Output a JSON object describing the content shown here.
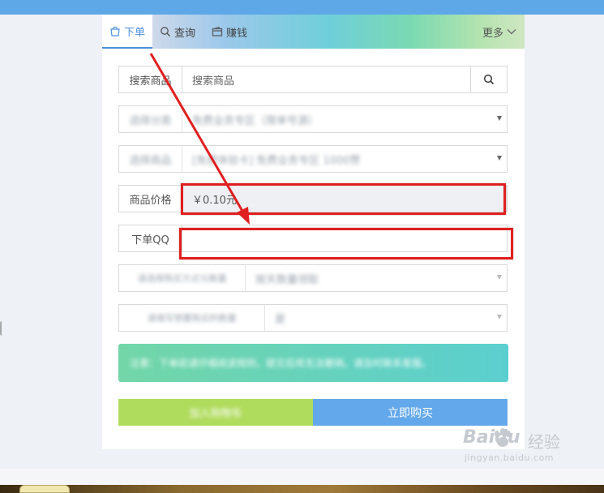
{
  "tabs": [
    {
      "label": "下单",
      "icon": "bag-icon",
      "active": true
    },
    {
      "label": "查询",
      "icon": "search-icon",
      "active": false
    },
    {
      "label": "赚钱",
      "icon": "wallet-icon",
      "active": false
    }
  ],
  "more_label": "更多",
  "search": {
    "label": "搜索商品",
    "placeholder": "搜索商品"
  },
  "category": {
    "label": "选择分类",
    "value": "免费业务专区（限单号源）"
  },
  "product": {
    "label": "选择商品",
    "value": "[免费体验卡] 免费业务专区 1000赞"
  },
  "price": {
    "label": "商品价格",
    "value": "￥0.10元"
  },
  "qq": {
    "label": "下单QQ",
    "value": ""
  },
  "extra1": {
    "label": "请选择购买方式与数量",
    "value": "按天数量领取"
  },
  "extra2": {
    "label": "请填写想要购买的数量",
    "value": "是"
  },
  "notice_text": "注意：下单前请仔细阅读规则，提交后将无法撤销。请及时联系客服。",
  "buttons": {
    "cart": "加入购物车",
    "buy": "立即购买"
  },
  "watermark": {
    "brand": "Baidu",
    "cn": "经验",
    "url": "jingyan.baidu.com"
  },
  "colors": {
    "accent": "#4a90d9",
    "buy_button": "#63a8ea",
    "cart_button": "#b0dc5e",
    "annotation": "#e02020"
  }
}
